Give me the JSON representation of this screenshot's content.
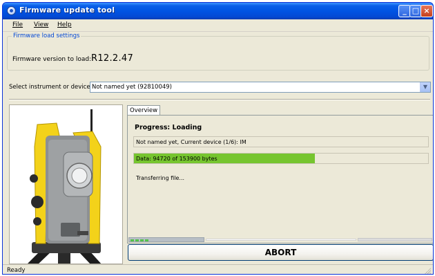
{
  "window": {
    "title": "Firmware update tool",
    "controls": {
      "minimize": "_",
      "maximize": "□",
      "close": "×"
    }
  },
  "menu": [
    {
      "key": "F",
      "rest": "ile"
    },
    {
      "key": "V",
      "rest": "iew"
    },
    {
      "key": "H",
      "rest": "elp"
    }
  ],
  "settings": {
    "group_label": "Firmware load settings",
    "version_label": "Firmware version to load:",
    "version_value": "R12.2.47"
  },
  "device": {
    "select_label": "Select instrument or device:",
    "selected_value": "Not named yet (92810049)"
  },
  "tabs": [
    {
      "label": "Overview"
    }
  ],
  "progress": {
    "title": "Progress: Loading",
    "current_device": "Not named yet, Current device (1/6): IM",
    "data_text": "Data: 94720 of 153900 bytes",
    "fraction": 0.6155,
    "transfer_text": "Transferring file..."
  },
  "abort_label": "ABORT",
  "status_text": "Ready",
  "colors": {
    "titlebar": "#0054e3",
    "progress_fill": "#76c52f",
    "group_legend": "#0046d5"
  }
}
